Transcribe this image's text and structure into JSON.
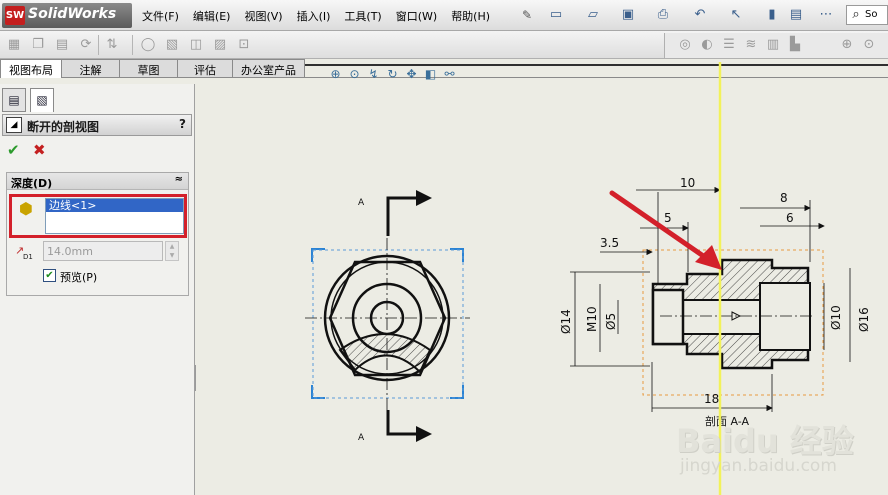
{
  "app": {
    "logo_mark": "SW",
    "brand": "SolidWorks"
  },
  "menu": [
    "文件(F)",
    "编辑(E)",
    "视图(V)",
    "插入(I)",
    "工具(T)",
    "窗口(W)",
    "帮助(H)"
  ],
  "search": {
    "label": "So"
  },
  "cmd_tabs": [
    "视图布局",
    "注解",
    "草图",
    "评估",
    "办公室产品"
  ],
  "panel": {
    "title": "断开的剖视图",
    "help": "?",
    "ok": "✔",
    "cancel": "✖",
    "group": {
      "title": "深度(D)",
      "collapse": "≈"
    },
    "edge_item": "边线<1>",
    "depth_value": "14.0mm",
    "depth_sub": "D1",
    "preview_label": "预览(P)",
    "preview_checked": "✔"
  },
  "drawing": {
    "section_letter_top": "A",
    "section_letter_bottom": "A",
    "dims": {
      "d10": "10",
      "d8": "8",
      "d5": "5",
      "d6": "6",
      "d35": "3.5",
      "phi14": "Ø14",
      "m10": "M10",
      "phi5": "Ø5",
      "phi10": "Ø10",
      "phi16": "Ø16",
      "d18": "18"
    },
    "section_label": "剖面 A-A"
  },
  "watermark": {
    "brand": "Baidu 经验",
    "url": "jingyan.baidu.com"
  },
  "colors": {
    "annotation_red": "#d3202a",
    "yellow_line": "#f2f25a",
    "selection_blue": "#3166c6"
  }
}
